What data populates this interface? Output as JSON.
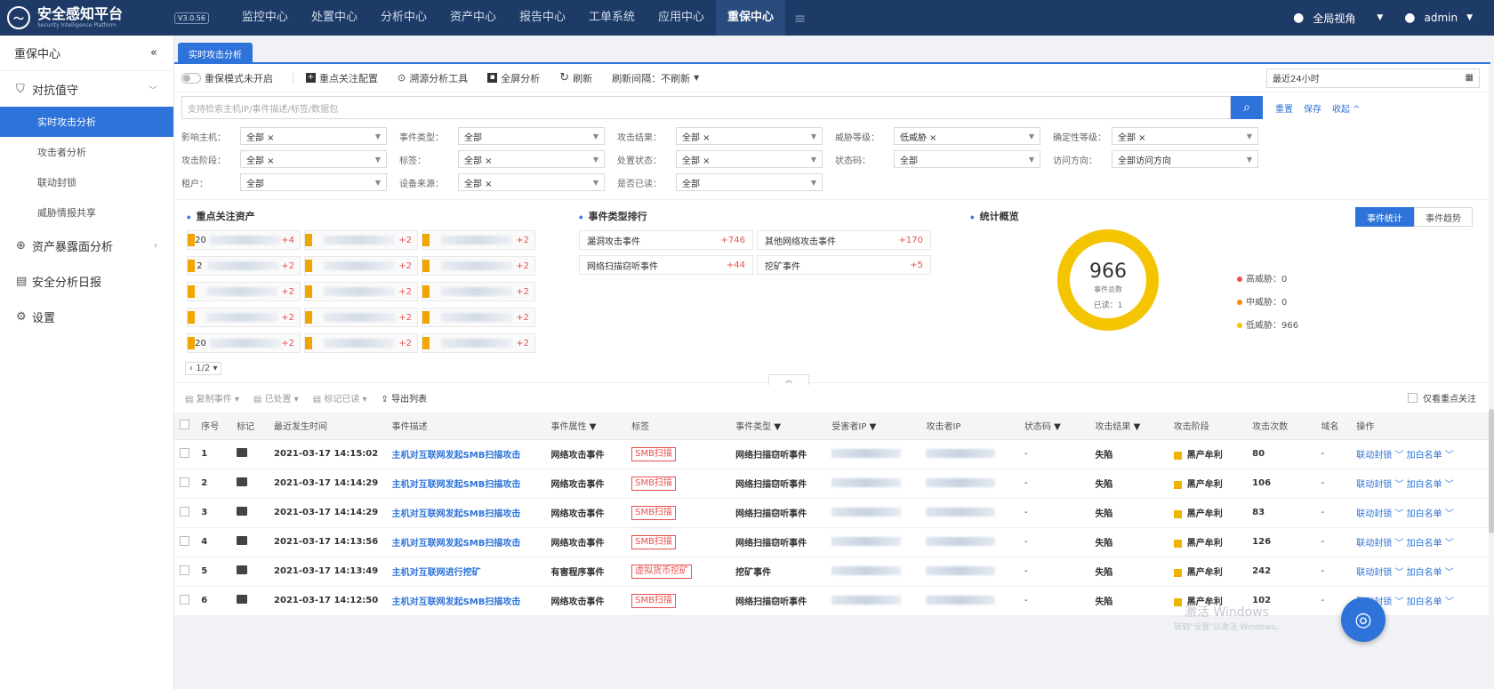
{
  "app": {
    "title": "安全感知平台",
    "subtitle": "Security Intelligence Platform",
    "version": "V3.0.56"
  },
  "nav": [
    "监控中心",
    "处置中心",
    "分析中心",
    "资产中心",
    "报告中心",
    "工单系统",
    "应用中心",
    "重保中心"
  ],
  "nav_active": "重保中心",
  "topright": {
    "view": "全局视角",
    "user": "admin"
  },
  "sidebar": {
    "title": "重保中心",
    "groups": [
      {
        "label": "对抗值守",
        "icon": "shield-icon"
      },
      {
        "label": "资产暴露面分析",
        "icon": "globe-icon"
      },
      {
        "label": "安全分析日报",
        "icon": "doc-icon"
      },
      {
        "label": "设置",
        "icon": "gear-icon"
      }
    ],
    "subs": [
      "实时攻击分析",
      "攻击者分析",
      "联动封锁",
      "威胁情报共享"
    ]
  },
  "tab": "实时攻击分析",
  "toolbar": {
    "toggle": "重保模式未开启",
    "config": "重点关注配置",
    "trace": "溯源分析工具",
    "fullscreen": "全屏分析",
    "refresh": "刷新",
    "interval": "刷新间隔：不刷新"
  },
  "daterange": "最近24小时",
  "search": {
    "placeholder": "支持检索主机IP/事件描述/标签/数据包",
    "reset": "重置",
    "save": "保存",
    "collapse": "收起"
  },
  "filters": [
    [
      {
        "label": "影响主机：",
        "value": "全部 ×"
      },
      {
        "label": "事件类型：",
        "value": "全部"
      },
      {
        "label": "攻击结果：",
        "value": "全部 ×"
      },
      {
        "label": "威胁等级：",
        "value": "低威胁 ×"
      },
      {
        "label": "确定性等级：",
        "value": "全部 ×"
      }
    ],
    [
      {
        "label": "攻击阶段：",
        "value": "全部 ×"
      },
      {
        "label": "标签：",
        "value": "全部 ×"
      },
      {
        "label": "处置状态：",
        "value": "全部 ×"
      },
      {
        "label": "状态码：",
        "value": "全部"
      },
      {
        "label": "访问方向：",
        "value": "全部访问方向"
      }
    ],
    [
      {
        "label": "租户：",
        "value": "全部"
      },
      {
        "label": "设备来源：",
        "value": "全部 ×"
      },
      {
        "label": "是否已读：",
        "value": "全部"
      }
    ]
  ],
  "focus_assets": {
    "title": "重点关注资产",
    "items": [
      {
        "prefix": "20",
        "inc": "+4"
      },
      {
        "prefix": "",
        "inc": "+2"
      },
      {
        "prefix": "",
        "inc": "+2"
      },
      {
        "prefix": "2",
        "inc": "+2"
      },
      {
        "prefix": "",
        "inc": "+2"
      },
      {
        "prefix": "",
        "inc": "+2"
      },
      {
        "prefix": "",
        "inc": "+2"
      },
      {
        "prefix": "",
        "inc": "+2"
      },
      {
        "prefix": "",
        "inc": "+2"
      },
      {
        "prefix": "",
        "inc": "+2"
      },
      {
        "prefix": "",
        "inc": "+2"
      },
      {
        "prefix": "",
        "inc": "+2"
      },
      {
        "prefix": "20",
        "inc": "+2"
      },
      {
        "prefix": "",
        "inc": "+2"
      },
      {
        "prefix": "",
        "inc": "+2"
      }
    ],
    "pager": "1/2"
  },
  "event_rank": {
    "title": "事件类型排行",
    "items": [
      {
        "name": "漏洞攻击事件",
        "inc": "+746"
      },
      {
        "name": "其他网络攻击事件",
        "inc": "+170"
      },
      {
        "name": "网络扫描窃听事件",
        "inc": "+44"
      },
      {
        "name": "挖矿事件",
        "inc": "+5"
      }
    ]
  },
  "overview": {
    "title": "统计概览",
    "total": "966",
    "total_label": "事件总数",
    "read": "已读：1",
    "legend": [
      {
        "label": "高威胁：0",
        "color": "#e85050"
      },
      {
        "label": "中威胁：0",
        "color": "#f08c00"
      },
      {
        "label": "低威胁：966",
        "color": "#f5c400"
      }
    ],
    "tabs": [
      "事件统计",
      "事件趋势"
    ]
  },
  "list_toolbar": {
    "copy": "复制事件",
    "handled": "已处置",
    "mark": "标记已读",
    "export": "导出列表",
    "only_focus": "仅看重点关注"
  },
  "table": {
    "headers": [
      "序号",
      "标记",
      "最近发生时间",
      "事件描述",
      "事件属性",
      "标签",
      "事件类型",
      "受害者IP",
      "攻击者IP",
      "状态码",
      "攻击结果",
      "攻击阶段",
      "攻击次数",
      "域名",
      "操作"
    ],
    "rows": [
      {
        "no": "1",
        "time": "2021-03-17 14:15:02",
        "desc": "主机对互联网发起SMB扫描攻击",
        "attr": "网络攻击事件",
        "tag": "SMB扫描",
        "type": "网络扫描窃听事件",
        "code": "-",
        "result": "失陷",
        "stage": "黑产牟利",
        "count": "80",
        "domain": "-"
      },
      {
        "no": "2",
        "time": "2021-03-17 14:14:29",
        "desc": "主机对互联网发起SMB扫描攻击",
        "attr": "网络攻击事件",
        "tag": "SMB扫描",
        "type": "网络扫描窃听事件",
        "code": "-",
        "result": "失陷",
        "stage": "黑产牟利",
        "count": "106",
        "domain": "-"
      },
      {
        "no": "3",
        "time": "2021-03-17 14:14:29",
        "desc": "主机对互联网发起SMB扫描攻击",
        "attr": "网络攻击事件",
        "tag": "SMB扫描",
        "type": "网络扫描窃听事件",
        "code": "-",
        "result": "失陷",
        "stage": "黑产牟利",
        "count": "83",
        "domain": "-"
      },
      {
        "no": "4",
        "time": "2021-03-17 14:13:56",
        "desc": "主机对互联网发起SMB扫描攻击",
        "attr": "网络攻击事件",
        "tag": "SMB扫描",
        "type": "网络扫描窃听事件",
        "code": "-",
        "result": "失陷",
        "stage": "黑产牟利",
        "count": "126",
        "domain": "-"
      },
      {
        "no": "5",
        "time": "2021-03-17 14:13:49",
        "desc": "主机对互联网进行挖矿",
        "attr": "有害程序事件",
        "tag": "虚拟货币挖矿",
        "type": "挖矿事件",
        "code": "-",
        "result": "失陷",
        "stage": "黑产牟利",
        "count": "242",
        "domain": "-"
      },
      {
        "no": "6",
        "time": "2021-03-17 14:12:50",
        "desc": "主机对互联网发起SMB扫描攻击",
        "attr": "网络攻击事件",
        "tag": "SMB扫描",
        "type": "网络扫描窃听事件",
        "code": "-",
        "result": "失陷",
        "stage": "黑产牟利",
        "count": "102",
        "domain": "-"
      }
    ],
    "op1": "联动封锁",
    "op2": "加白名单"
  },
  "watermark": {
    "line1": "激活 Windows",
    "line2": "转到\"设置\"以激活 Windows。"
  }
}
